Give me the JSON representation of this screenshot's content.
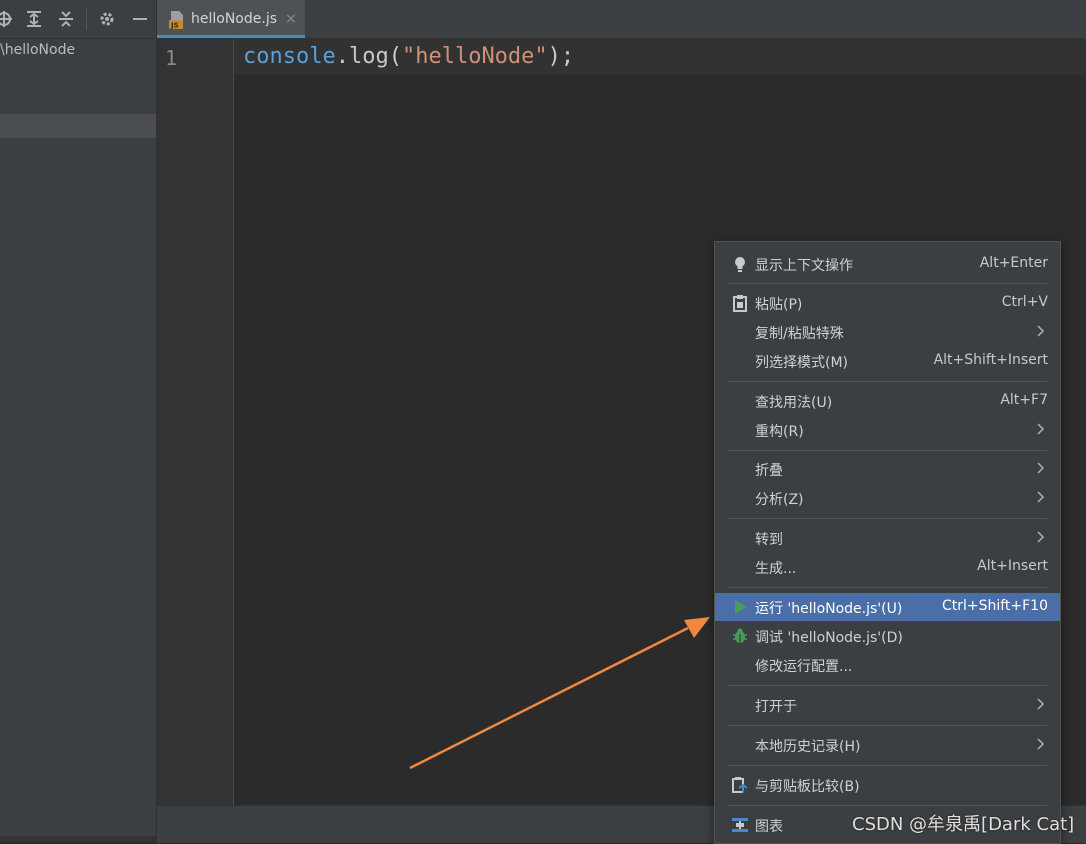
{
  "project_panel": {
    "tree_root_label": "\\helloNode",
    "toolbar_icons": [
      "locate-icon",
      "expand-all-icon",
      "collapse-all-icon",
      "gear-icon",
      "minimize-icon"
    ]
  },
  "tab": {
    "title": "helloNode.js",
    "close": "×",
    "file_icon_text": "JS"
  },
  "editor": {
    "line_number": "1",
    "code": {
      "object": "console",
      "dot": ".",
      "method": "log",
      "open_paren": "(",
      "string": "\"helloNode\"",
      "close": ");"
    }
  },
  "context_menu": {
    "items": [
      {
        "label": "显示上下文操作",
        "shortcut": "Alt+Enter",
        "icon": "lightbulb-icon"
      },
      {
        "label": "粘贴(P)",
        "shortcut": "Ctrl+V",
        "icon": "clipboard-icon"
      },
      {
        "label": "复制/粘贴特殊",
        "shortcut": ""
      },
      {
        "label": "列选择模式(M)",
        "shortcut": "Alt+Shift+Insert"
      },
      {
        "label": "查找用法(U)",
        "shortcut": "Alt+F7"
      },
      {
        "label": "重构(R)",
        "shortcut": ""
      },
      {
        "label": "折叠",
        "shortcut": ""
      },
      {
        "label": "分析(Z)",
        "shortcut": ""
      },
      {
        "label": "转到",
        "shortcut": ""
      },
      {
        "label": "生成...",
        "shortcut": "Alt+Insert"
      },
      {
        "label": "运行 'helloNode.js'(U)",
        "shortcut": "Ctrl+Shift+F10",
        "icon": "run-icon",
        "selected": true
      },
      {
        "label": "调试 'helloNode.js'(D)",
        "shortcut": "",
        "icon": "debug-icon"
      },
      {
        "label": "修改运行配置...",
        "shortcut": ""
      },
      {
        "label": "打开于",
        "shortcut": ""
      },
      {
        "label": "本地历史记录(H)",
        "shortcut": ""
      },
      {
        "label": "与剪贴板比较(B)",
        "shortcut": "",
        "icon": "compare-clipboard-icon"
      },
      {
        "label": "图表",
        "shortcut": "",
        "icon": "diagram-icon"
      }
    ]
  },
  "watermark": "CSDN @牟泉禹[Dark Cat]",
  "colors": {
    "selection": "#4a6fa8",
    "annotation_arrow": "#f0883e",
    "run_green": "#499c54"
  }
}
